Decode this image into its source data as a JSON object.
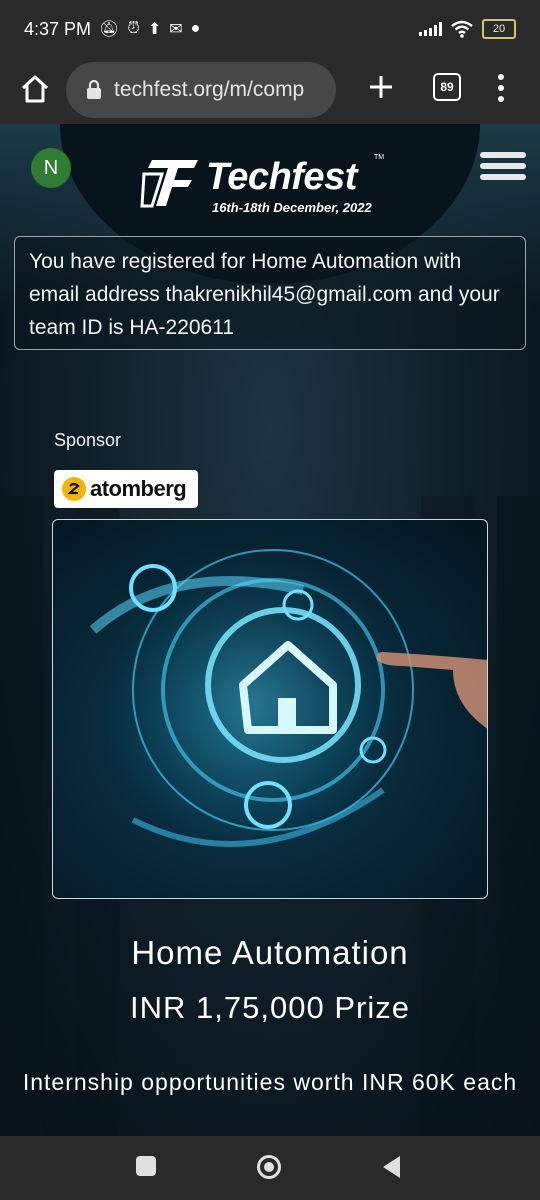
{
  "status_bar": {
    "time": "4:37 PM",
    "battery": "20",
    "icons": [
      "mute-icon",
      "alarm-icon",
      "upload-icon",
      "gmail-icon",
      "whatsapp-icon",
      "signal-icon",
      "wifi-icon",
      "battery-icon"
    ]
  },
  "browser": {
    "url": "techfest.org/m/comp",
    "tab_count": "89",
    "icons": [
      "home-icon",
      "lock-icon",
      "plus-icon",
      "tabs-icon",
      "more-vert-icon"
    ]
  },
  "header": {
    "avatar_initial": "N",
    "logo_text": "Techfest",
    "logo_tm": "TM",
    "logo_dates": "16th-18th December, 2022",
    "avatar_color": "#2e7d32"
  },
  "notice": {
    "text": "You have registered for Home Automation with email address thakrenikhil45@gmail.com and your team ID is HA-220611"
  },
  "sponsor": {
    "label": "Sponsor",
    "name": "atomberg"
  },
  "event": {
    "title": "Home Automation",
    "prize": "INR 1,75,000 Prize",
    "internship": "Internship opportunities worth INR 60K each"
  },
  "nav": {
    "icons": [
      "recent-apps-icon",
      "home-circle-icon",
      "back-icon"
    ]
  }
}
